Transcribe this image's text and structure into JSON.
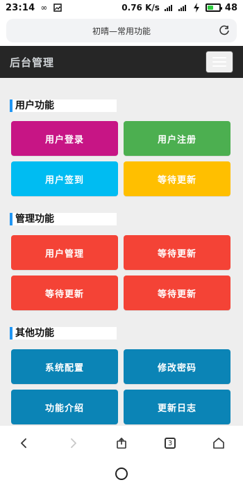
{
  "status_bar": {
    "time": "23:14",
    "speed": "0.76",
    "speed_unit": "K/s",
    "battery": "48"
  },
  "browser": {
    "url_title": "初晴—常用功能"
  },
  "header": {
    "title": "后台管理"
  },
  "sections": [
    {
      "title": "用户功能",
      "buttons": [
        {
          "label": "用户登录",
          "color": "#c71585"
        },
        {
          "label": "用户注册",
          "color": "#4caf50"
        },
        {
          "label": "用户签到",
          "color": "#00bcf2"
        },
        {
          "label": "等待更新",
          "color": "#ffbf00"
        }
      ]
    },
    {
      "title": "管理功能",
      "buttons": [
        {
          "label": "用户管理",
          "color": "#f44336"
        },
        {
          "label": "等待更新",
          "color": "#f44336"
        },
        {
          "label": "等待更新",
          "color": "#f44336"
        },
        {
          "label": "等待更新",
          "color": "#f44336"
        }
      ]
    },
    {
      "title": "其他功能",
      "buttons": [
        {
          "label": "系统配置",
          "color": "#0b84b6"
        },
        {
          "label": "修改密码",
          "color": "#0b84b6"
        },
        {
          "label": "功能介绍",
          "color": "#0b84b6"
        },
        {
          "label": "更新日志",
          "color": "#0b84b6"
        }
      ]
    }
  ],
  "bottom_nav": {
    "tab_count": "3"
  },
  "icons": {
    "infinity": "∞",
    "image": "🖼",
    "signal": "📶",
    "refresh": "⟳",
    "back": "‹",
    "forward": "›",
    "share": "⤴",
    "home": "⌂"
  },
  "colors": {
    "accent": "#2196f3",
    "header_bg": "#262626",
    "content_bg": "#eeeeee"
  }
}
